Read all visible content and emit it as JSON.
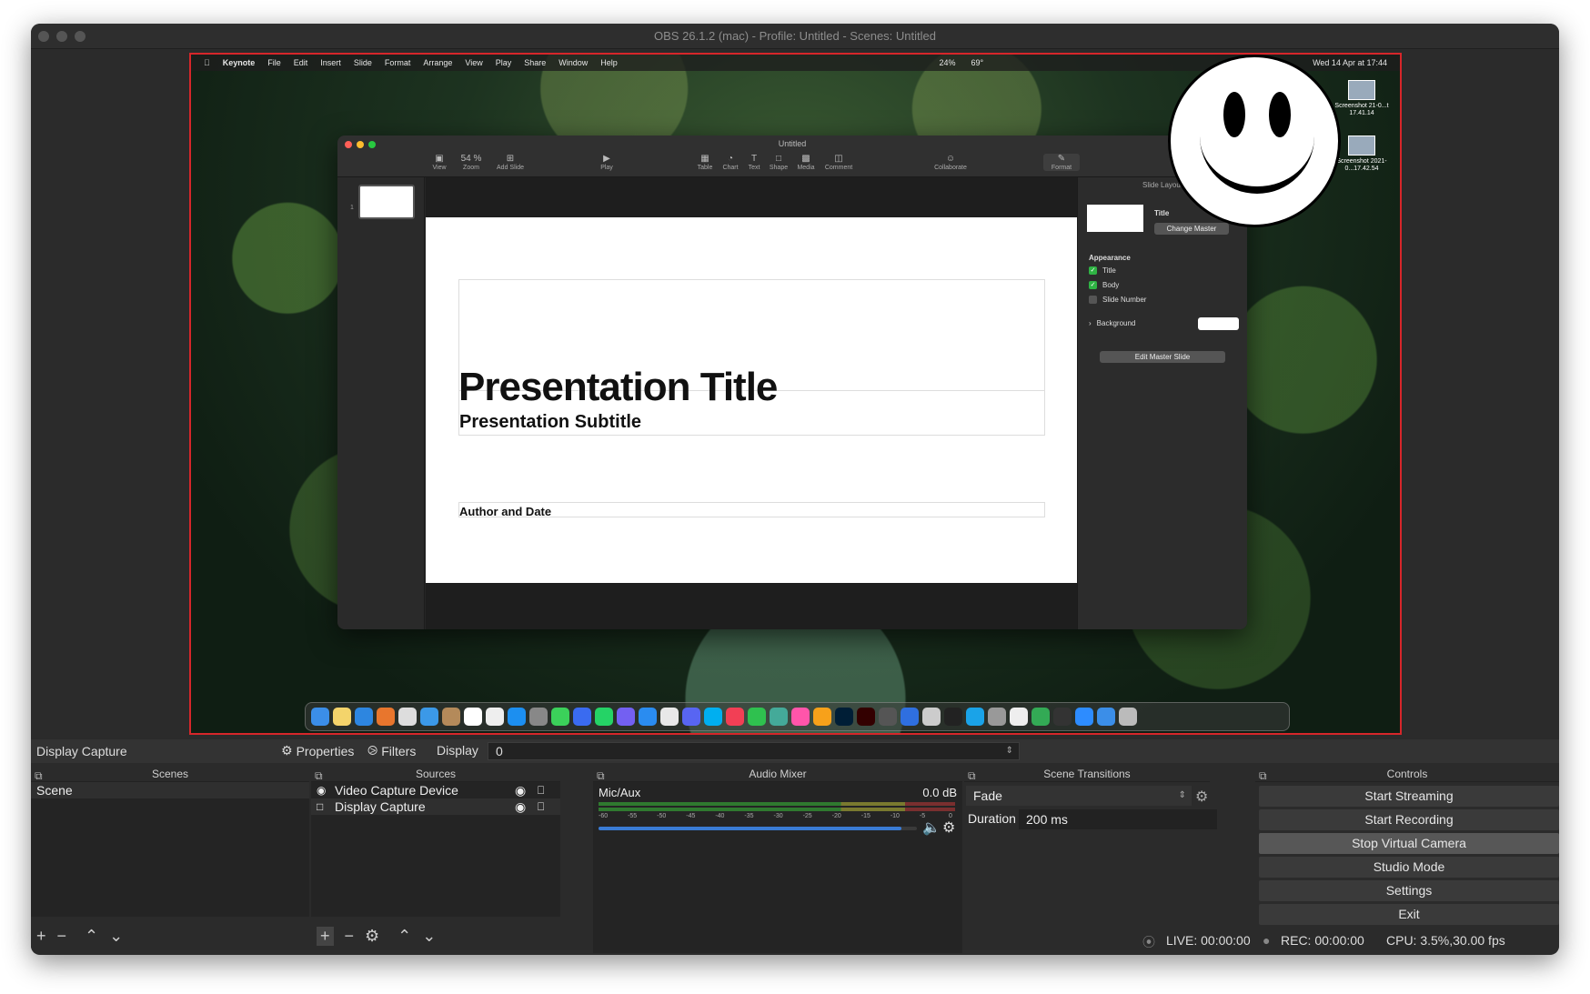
{
  "window": {
    "title": "OBS 26.1.2 (mac) - Profile: Untitled - Scenes: Untitled"
  },
  "preview": {
    "menubar": {
      "app": "Keynote",
      "items": [
        "File",
        "Edit",
        "Insert",
        "Slide",
        "Format",
        "Arrange",
        "View",
        "Play",
        "Share",
        "Window",
        "Help"
      ],
      "status_battery": "24%",
      "status_temp": "69°",
      "clock": "Wed 14 Apr at 17:44"
    },
    "desktop_icons": [
      {
        "label": "Screenshot 21-0...t 17.41.14"
      },
      {
        "label": "Screenshot 2021-0...17.42.54"
      }
    ],
    "keynote": {
      "doc_title": "Untitled",
      "toolbar": {
        "view": "View",
        "zoom_value": "54 %",
        "zoom": "Zoom",
        "add_slide": "Add Slide",
        "play": "Play",
        "table": "Table",
        "chart": "Chart",
        "text": "Text",
        "shape": "Shape",
        "media": "Media",
        "comment": "Comment",
        "collaborate": "Collaborate",
        "format": "Format"
      },
      "slide_number": "1",
      "slide": {
        "title": "Presentation Title",
        "subtitle": "Presentation Subtitle",
        "author": "Author and Date"
      },
      "inspector": {
        "header": "Slide Layout",
        "master_name": "Title",
        "change_master": "Change Master",
        "appearance": "Appearance",
        "title_opt": "Title",
        "body_opt": "Body",
        "slide_number_opt": "Slide Number",
        "background": "Background",
        "edit_master": "Edit Master Slide"
      }
    }
  },
  "source_toolbar": {
    "selected_source": "Display Capture",
    "properties": "Properties",
    "filters": "Filters",
    "display_label": "Display",
    "display_value": "0"
  },
  "panels": {
    "scenes": {
      "title": "Scenes",
      "items": [
        "Scene"
      ]
    },
    "sources": {
      "title": "Sources",
      "items": [
        "Video Capture Device",
        "Display Capture"
      ]
    },
    "audio_mixer": {
      "title": "Audio Mixer",
      "channel": "Mic/Aux",
      "level": "0.0 dB",
      "scale": [
        "-60",
        "-55",
        "-50",
        "-45",
        "-40",
        "-35",
        "-30",
        "-25",
        "-20",
        "-15",
        "-10",
        "-5",
        "0"
      ],
      "volume": 0.95
    },
    "transitions": {
      "title": "Scene Transitions",
      "type": "Fade",
      "duration_label": "Duration",
      "duration_value": "200 ms"
    },
    "controls": {
      "title": "Controls",
      "buttons": [
        "Start Streaming",
        "Start Recording",
        "Stop Virtual Camera",
        "Studio Mode",
        "Settings",
        "Exit"
      ]
    }
  },
  "statusbar": {
    "live": "LIVE: 00:00:00",
    "rec": "REC: 00:00:00",
    "cpu": "CPU: 3.5%,30.00 fps"
  },
  "colors": {
    "accent_red": "#d6262a",
    "volume_blue": "#3a7bd5"
  }
}
